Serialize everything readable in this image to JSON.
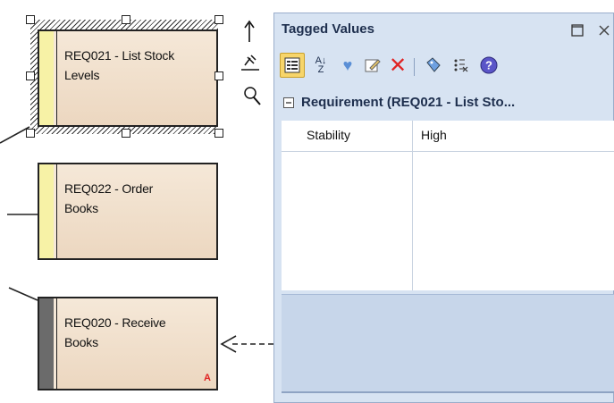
{
  "diagram": {
    "elements": [
      {
        "id": "req021",
        "line1": "REQ021 - List Stock",
        "line2": "Levels"
      },
      {
        "id": "req022",
        "line1": "REQ022 - Order",
        "line2": "Books"
      },
      {
        "id": "req020",
        "line1": "REQ020 - Receive",
        "line2": "Books",
        "marker": "A"
      }
    ],
    "colors": {
      "strip_yellow": "#f7f2a6",
      "strip_gray": "#6b6b6b",
      "marker_red": "#e02020",
      "fill": "#f0e0cc"
    }
  },
  "panel": {
    "title": "Tagged Values",
    "toolbar_icons": [
      "categorized-view-icon",
      "sort-az-icon",
      "new-tag-icon",
      "edit-tag-icon",
      "delete-icon",
      "tag-icon",
      "show-hidden-icon",
      "help-icon"
    ],
    "group_label": "Requirement (REQ021 - List Sto...",
    "rows": [
      {
        "name": "Stability",
        "value": "High"
      }
    ],
    "colors": {
      "panel_bg": "#d7e3f2",
      "title_text": "#1e2f4e",
      "desc_bg": "#c7d6ea"
    }
  }
}
